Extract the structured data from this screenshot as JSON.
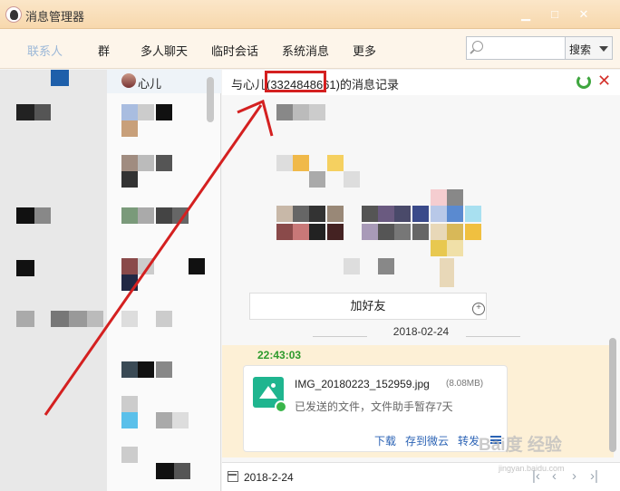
{
  "window": {
    "title": "消息管理器",
    "minimize": "▁",
    "maximize": "□",
    "close": "✕"
  },
  "tabs": [
    "联系人",
    "群",
    "多人聊天",
    "临时会话",
    "系统消息",
    "更多"
  ],
  "search": {
    "placeholder": "",
    "button": "搜索"
  },
  "contact_list": {
    "first_name": "心儿"
  },
  "chat": {
    "header": "与心儿(3324848661)的消息记录",
    "add_friend": "加好友",
    "date_divider": "2018-02-24",
    "message_time": "22:43:03",
    "file": {
      "name": "IMG_20180223_152959.jpg",
      "size": "(8.08MB)",
      "status": "已发送的文件，文件助手暂存7天",
      "actions": [
        "下载",
        "存到微云",
        "转发"
      ]
    },
    "footer_date": "2018-2-24"
  },
  "watermark": {
    "main": "Bai度 经验",
    "sub": "jingyan.baidu.com"
  },
  "colors": {
    "accent_red": "#d42020",
    "green": "#2c9a2c",
    "link": "#2b63b5"
  }
}
